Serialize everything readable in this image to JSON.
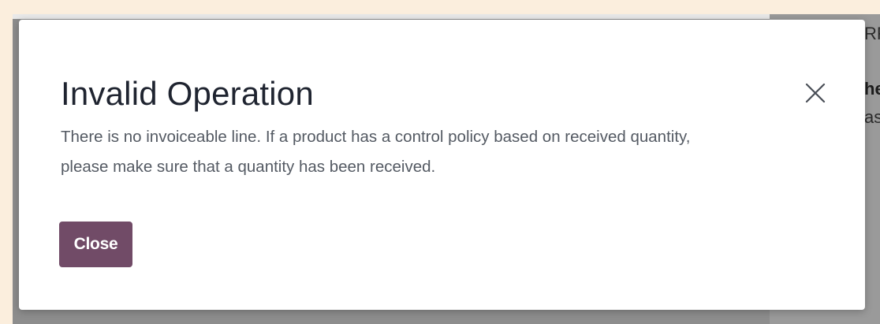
{
  "dialog": {
    "title": "Invalid Operation",
    "message_line1": "There is no invoiceable line. If a product has a control policy based on received quantity,",
    "message_line2": "please make sure that a quantity has been received.",
    "close_button_label": "Close",
    "close_icon": "close-icon"
  },
  "background": {
    "partial_text_1": "RF",
    "partial_text_2": "he",
    "partial_text_3": "as"
  },
  "colors": {
    "primary_button": "#714b67",
    "title_text": "#1f2430",
    "body_text": "#545a63",
    "overlay": "#8d8d8d",
    "page_border": "#fbeedd"
  }
}
